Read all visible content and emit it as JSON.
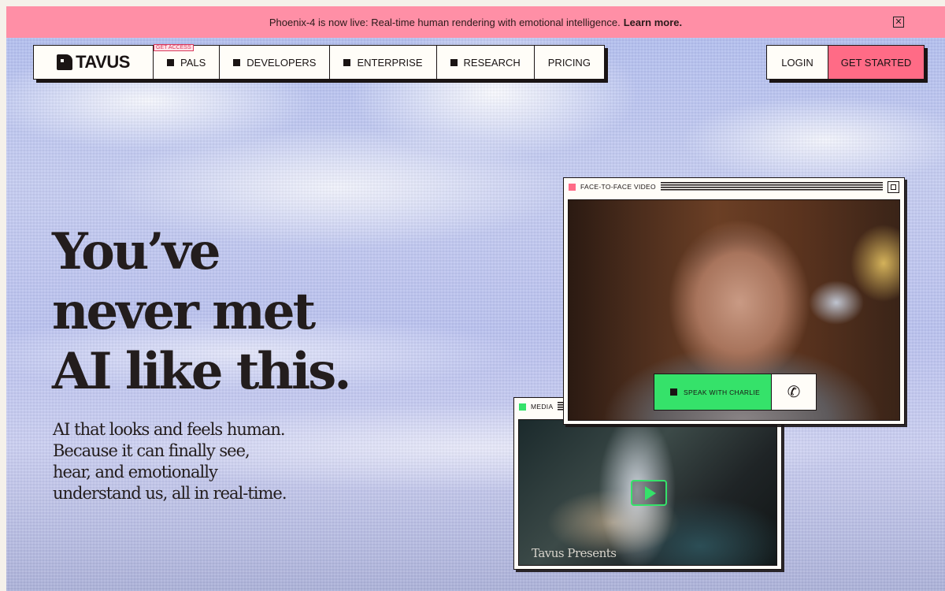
{
  "banner": {
    "text": "Phoenix-4 is now live: Real-time human rendering with emotional intelligence.",
    "link": "Learn more.",
    "close_glyph": "✕",
    "color": "#ff8fa6"
  },
  "nav": {
    "logo": "TAVUS",
    "badge": "GET ACCESS",
    "items": [
      {
        "label": "PALS",
        "icon": "square-icon"
      },
      {
        "label": "DEVELOPERS",
        "icon": "square-icon"
      },
      {
        "label": "ENTERPRISE",
        "icon": "square-icon"
      },
      {
        "label": "RESEARCH",
        "icon": "square-icon"
      },
      {
        "label": "PRICING"
      }
    ],
    "login": "LOGIN",
    "get_started": "GET STARTED",
    "accent": "#ff6b86"
  },
  "hero": {
    "title_lines": [
      "You’ve",
      "never met",
      "AI like this."
    ],
    "subtitle": "AI that looks and feels human. Because it can finally see, hear, and emotionally understand us, all in real-time."
  },
  "video_window": {
    "title": "FACE-TO-FACE VIDEO",
    "speak_label": "SPEAK WITH CHARLIE",
    "phone_glyph": "✆",
    "dot_color": "#ff6b86",
    "button_color": "#35e26a"
  },
  "media_window": {
    "title": "MEDIA",
    "caption": "Tavus Presents",
    "dot_color": "#35e26a"
  }
}
